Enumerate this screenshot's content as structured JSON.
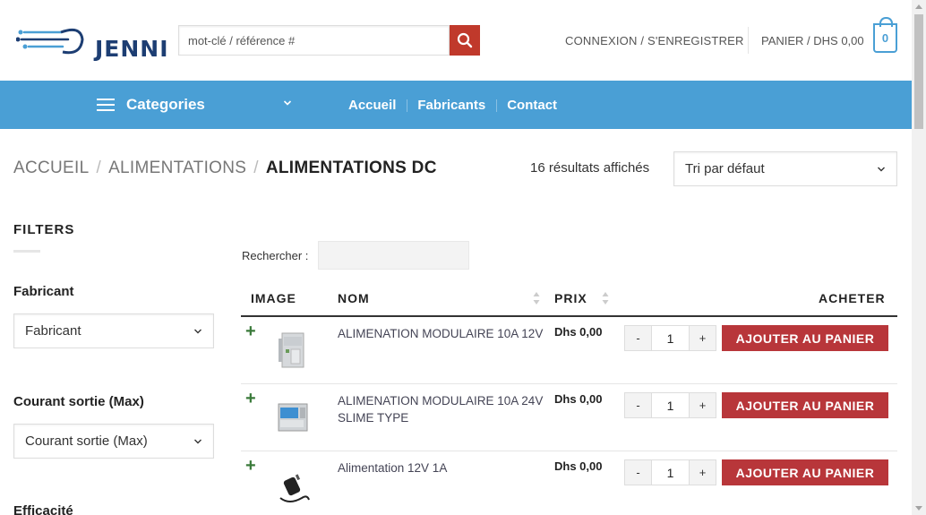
{
  "header": {
    "logo_text": "JENNI",
    "search_placeholder": "mot-clé / référence #",
    "login_label": "CONNEXION / S'ENREGISTRER",
    "cart_label": "PANIER / DHS 0,00",
    "cart_count": "0"
  },
  "nav": {
    "categories_label": "Categories",
    "links": [
      "Accueil",
      "Fabricants",
      "Contact"
    ]
  },
  "breadcrumb": {
    "items": [
      "ACCUEIL",
      "ALIMENTATIONS"
    ],
    "separator": "/",
    "current": "ALIMENTATIONS DC"
  },
  "results": {
    "count_label": "16 résultats affichés",
    "sort_value": "Tri par défaut"
  },
  "sidebar": {
    "title": "FILTERS",
    "filters": [
      {
        "label": "Fabricant",
        "value": "Fabricant"
      },
      {
        "label": "Courant sortie (Max)",
        "value": "Courant sortie (Max)"
      },
      {
        "label": "Efficacité"
      }
    ]
  },
  "table": {
    "search_label": "Rechercher :",
    "headers": {
      "image": "IMAGE",
      "name": "NOM",
      "price": "PRIX",
      "buy": "ACHETER"
    },
    "add_label": "AJOUTER AU PANIER",
    "rows": [
      {
        "name": "ALIMENATION MODULAIRE 10A 12V",
        "price": "Dhs 0,00",
        "qty": "1",
        "image": "din-rail-psu"
      },
      {
        "name": "ALIMENATION MODULAIRE 10A 24V SLIME TYPE",
        "price": "Dhs 0,00",
        "qty": "1",
        "image": "slim-psu"
      },
      {
        "name": "Alimentation 12V 1A",
        "price": "Dhs 0,00",
        "qty": "1",
        "image": "wall-adapter"
      }
    ]
  },
  "colors": {
    "nav_bg": "#4a9fd5",
    "accent_red": "#b8363a",
    "search_btn": "#c0392b",
    "logo_blue": "#1d3e73"
  }
}
